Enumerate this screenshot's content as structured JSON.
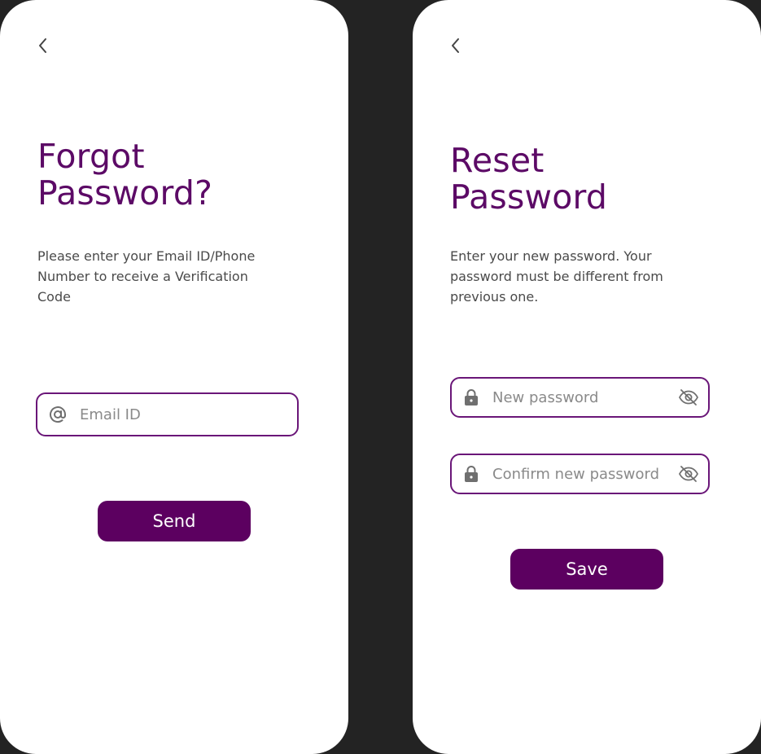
{
  "colors": {
    "background": "#232323",
    "screen": "#ffffff",
    "title": "#5c0a66",
    "field_border": "#6a1678",
    "button": "#5c0060",
    "icon": "#6f6f6f"
  },
  "forgot_password": {
    "back_icon": "chevron-left-icon",
    "title_line1": "Forgot",
    "title_line2": "Password?",
    "description_line1": "Please enter your Email ID/Phone",
    "description_line2": "Number to receive a Verification",
    "description_line3": "Code",
    "email_field": {
      "icon": "at-sign-icon",
      "placeholder": "Email ID",
      "value": ""
    },
    "send_label": "Send"
  },
  "reset_password": {
    "back_icon": "chevron-left-icon",
    "title_line1": "Reset",
    "title_line2": "Password",
    "description_line1": "Enter your new password. Your",
    "description_line2": "password must be different from",
    "description_line3": "previous one.",
    "new_password_field": {
      "icon": "lock-icon",
      "placeholder": "New password",
      "value": "",
      "toggle_icon": "eye-off-icon"
    },
    "confirm_password_field": {
      "icon": "lock-icon",
      "placeholder": "Confirm new password",
      "value": "",
      "toggle_icon": "eye-off-icon"
    },
    "save_label": "Save"
  }
}
